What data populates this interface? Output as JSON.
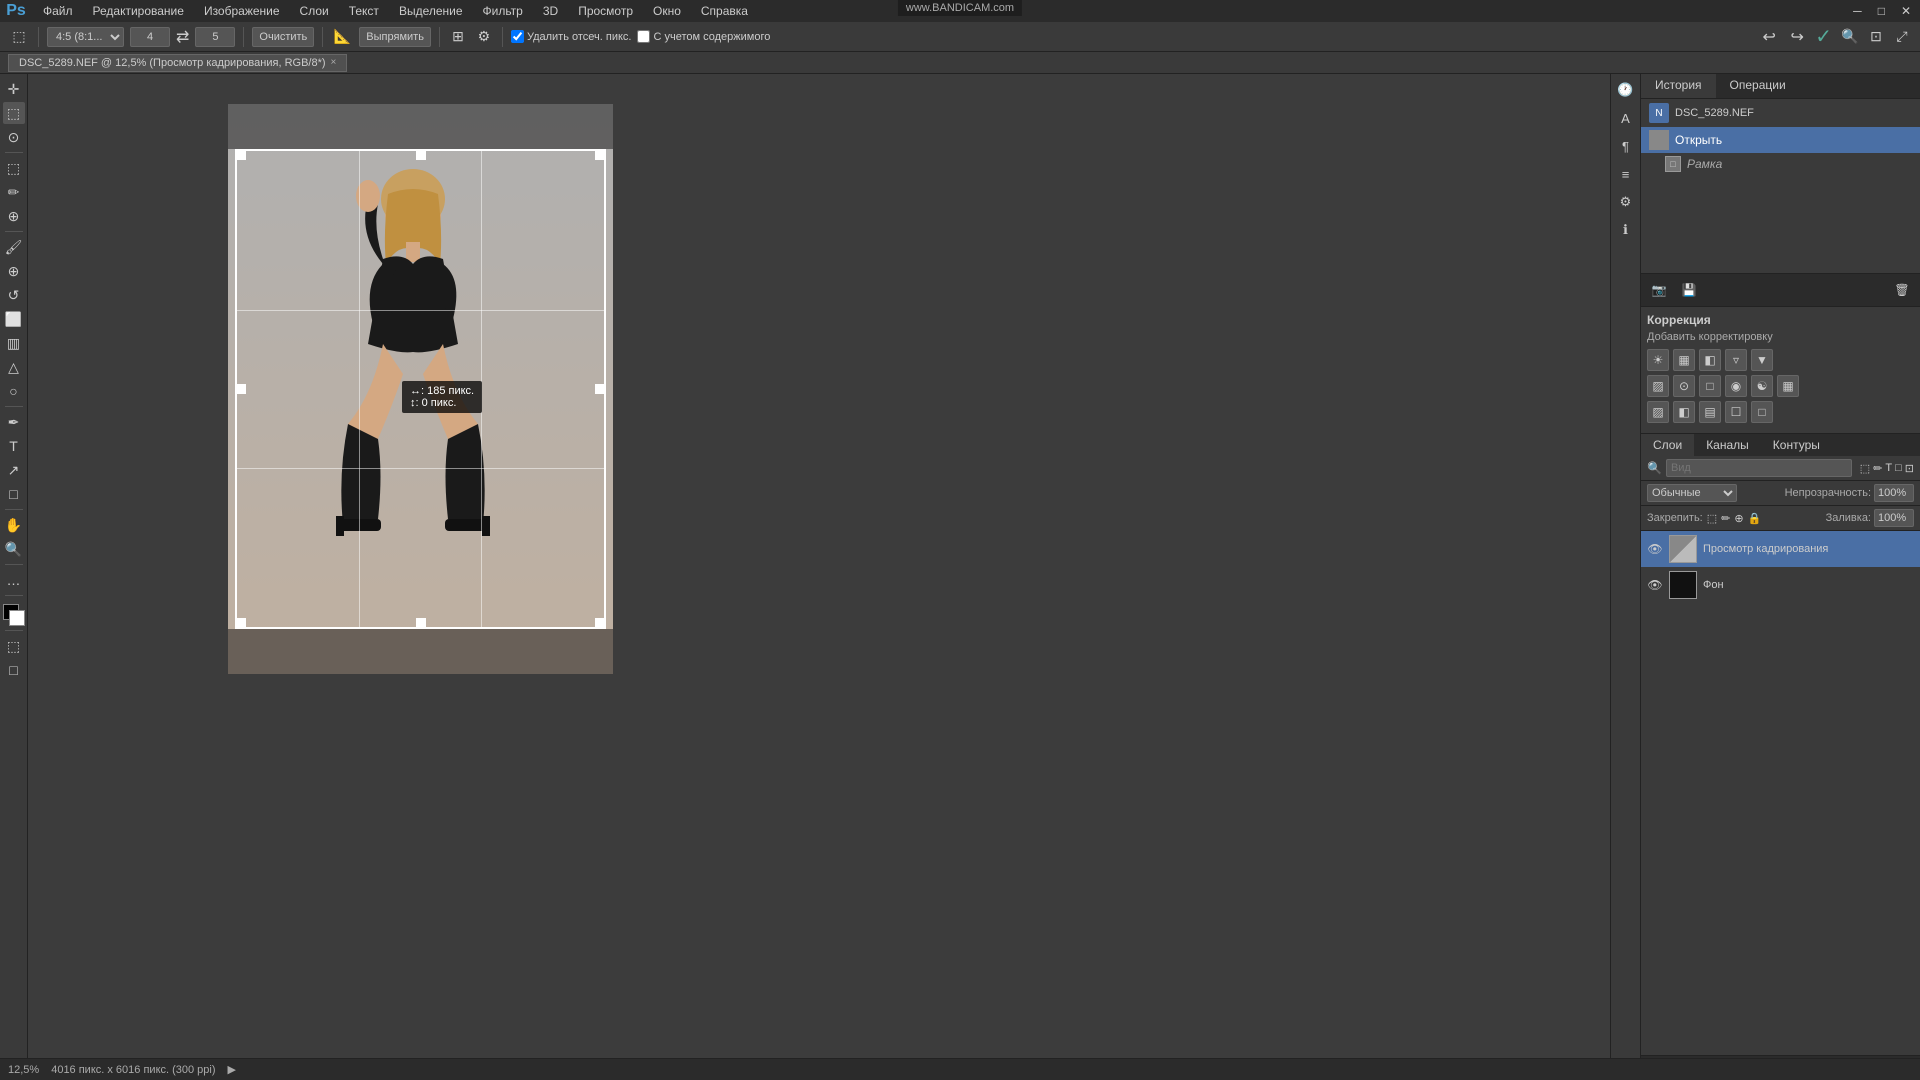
{
  "menubar": {
    "items": [
      "Файл",
      "Редактирование",
      "Изображение",
      "Слои",
      "Текст",
      "Выделение",
      "Фильтр",
      "3D",
      "Просмотр",
      "Окно",
      "Справка"
    ]
  },
  "watermark": "www.BANDICAM.com",
  "toolbar": {
    "ratio_label": "4:5 (8:1...",
    "swap_label": "⇄",
    "input_val": "5",
    "clear_btn": "Очистить",
    "straighten_btn": "Выпрямить",
    "grid_icon": "⊞",
    "settings_icon": "⚙",
    "delete_check": "Удалить отсеч. пикс.",
    "content_check": "С учетом содержимого",
    "undo_icon": "↩",
    "redo_icon": "↪",
    "confirm_icon": "✓",
    "input_val2": "4"
  },
  "tab": {
    "title": "DSC_5289.NEF @ 12,5% (Просмотр кадрирования, RGB/8*)",
    "close": "×"
  },
  "history": {
    "tab_history": "История",
    "tab_operations": "Операции",
    "file_icon_label": "DSC_5289.NEF",
    "item1": "Открыть",
    "item2": "Рамка"
  },
  "right_strip_icons": [
    "⊞",
    "A",
    "¶",
    "≡",
    "⚙",
    "ℹ"
  ],
  "correction": {
    "title": "Коррекция",
    "subtitle": "Добавить корректировку",
    "icons_row1": [
      "☀",
      "▦",
      "◧",
      "▿",
      "▼"
    ],
    "icons_row2": [
      "▨",
      "⊙",
      "□",
      "◉",
      "☯",
      "▦"
    ],
    "icons_row3": [
      "▨",
      "◧",
      "▤",
      "☐",
      "□"
    ]
  },
  "layers": {
    "tab_layers": "Слои",
    "tab_channels": "Каналы",
    "tab_contours": "Контуры",
    "search_placeholder": "Вид",
    "blend_mode": "Обычные",
    "opacity_label": "Непрозрачность:",
    "opacity_val": "100%",
    "lock_label": "Закрепить:",
    "fill_label": "Заливка:",
    "fill_val": "100%",
    "layer1_name": "Просмотр кадрирования",
    "layer2_name": "Фон"
  },
  "statusbar": {
    "zoom": "12,5%",
    "dimensions": "4016 пикс. x 6016 пикс. (300 ppi)",
    "arrow": "▶"
  },
  "tooltip": {
    "line1": "↔: 185 пикс.",
    "line2": "↕:   0 пикс."
  }
}
